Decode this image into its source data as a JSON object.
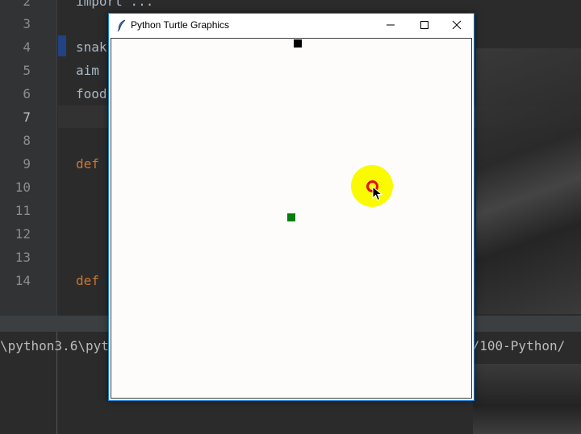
{
  "ide": {
    "line_numbers": [
      "2",
      "3",
      "4",
      "5",
      "6",
      "7",
      "8",
      "9",
      "10",
      "11",
      "12",
      "13",
      "14"
    ],
    "code_lines": [
      {
        "text": "import ...",
        "kind": "text"
      },
      {
        "text": "snak",
        "kind": "text"
      },
      {
        "text": "aim",
        "kind": "text"
      },
      {
        "text": "food",
        "kind": "text"
      },
      {
        "text": "def",
        "kind": "keyword"
      },
      {
        "text": "def",
        "kind": "keyword"
      }
    ],
    "terminal": {
      "path_left": "\\python3.6\\pyt",
      "path_right": "s/100-Python/"
    }
  },
  "turtle_window": {
    "title": "Python Turtle Graphics",
    "controls": {
      "minimize": "minimize",
      "maximize": "maximize",
      "close": "close"
    },
    "canvas": {
      "background": "#fdfcfb",
      "snake_color": "#000000",
      "food_color": "#067c0b",
      "click_highlight_color": "#fafa00",
      "click_ring_color": "#e01010"
    }
  },
  "colors": {
    "ide_background": "#2b2b2b",
    "keyword": "#cc7832",
    "text": "#a9b7c6",
    "window_border": "#1883d7"
  }
}
